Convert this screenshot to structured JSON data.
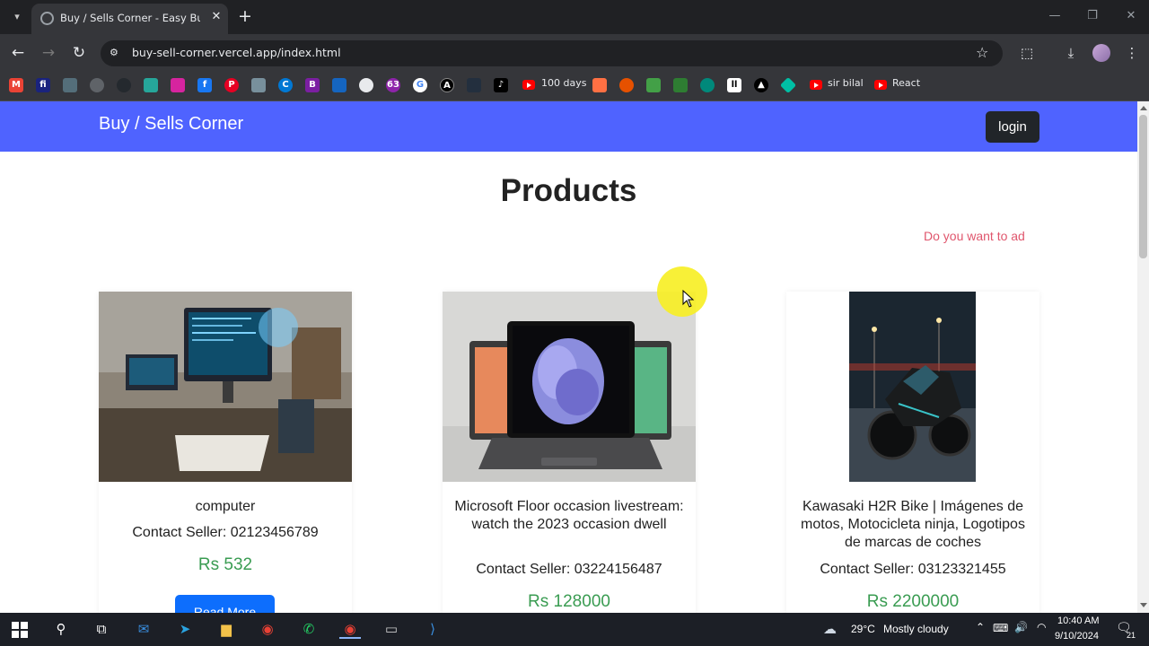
{
  "browser": {
    "tab_title": "Buy / Sells Corner - Easy Buy a",
    "url": "buy-sell-corner.vercel.app/index.html",
    "bookmarks": [
      {
        "label": "100 days"
      },
      {
        "label": "sir bilal"
      },
      {
        "label": "React"
      }
    ]
  },
  "site": {
    "brand": "Buy / Sells Corner",
    "login_label": "login",
    "heading": "Products",
    "ad_prompt": "Do you want to ad"
  },
  "products": [
    {
      "title": "computer",
      "contact": "Contact Seller: 02123456789",
      "price": "Rs 532",
      "button": "Read More"
    },
    {
      "title": "Microsoft Floor occasion livestream: watch the 2023 occasion dwell",
      "contact": "Contact Seller: 03224156487",
      "price": "Rs 128000"
    },
    {
      "title": "Kawasaki H2R Bike | Imágenes de motos, Motocicleta ninja, Logotipos de marcas de coches",
      "contact": "Contact Seller: 03123321455",
      "price": "Rs 2200000"
    }
  ],
  "taskbar": {
    "weather_temp": "29°C",
    "weather_text": "Mostly cloudy",
    "time": "10:40 AM",
    "date": "9/10/2024",
    "notification_count": "21"
  },
  "colors": {
    "navbar": "#4f63ff",
    "price": "#3a9c52",
    "ad_link": "#e0566d",
    "button": "#0d6efd"
  }
}
